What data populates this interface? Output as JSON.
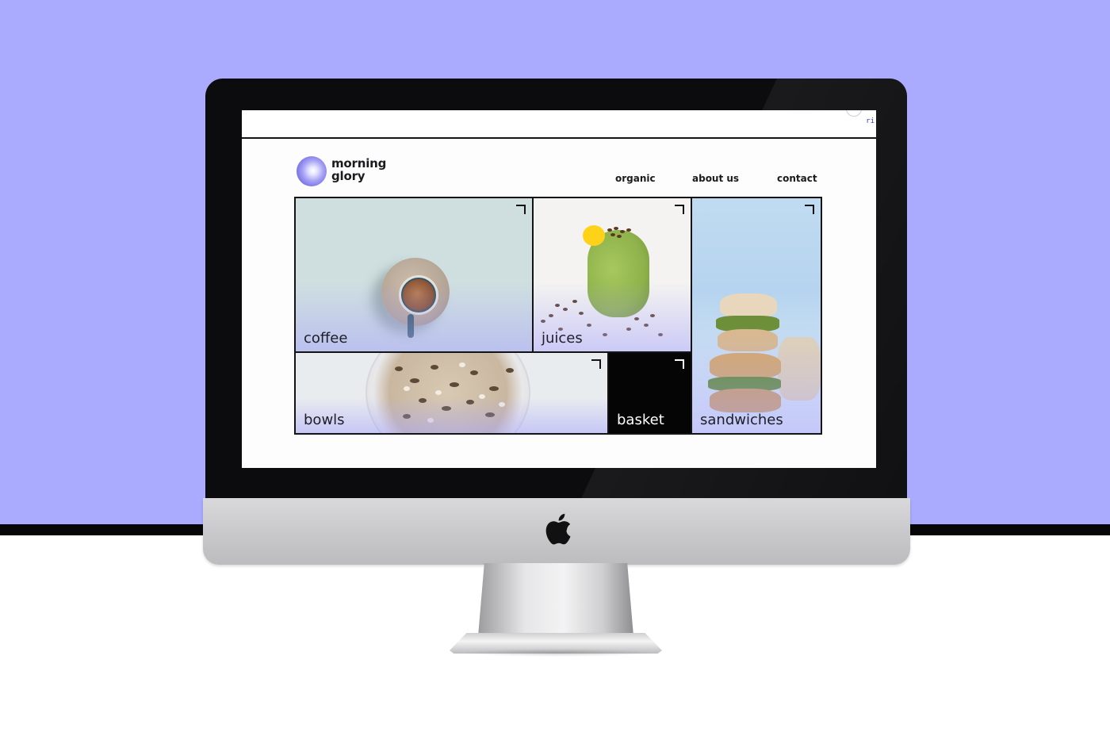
{
  "brand": {
    "line1": "morning",
    "line2": "glory"
  },
  "nav": {
    "organic": "organic",
    "about": "about us",
    "contact": "contact"
  },
  "topbar": {
    "code_fragment": "ri"
  },
  "tiles": {
    "coffee": "coffee",
    "juices": "juices",
    "sandwiches": "sandwiches",
    "bowls": "bowls",
    "basket": "basket"
  },
  "colors": {
    "backdrop": "#aaaafe",
    "accent": "#6d66e2",
    "ink": "#1b1b1f"
  },
  "icons": {
    "logo": "orb-logo-icon",
    "tile_corner": "corner-arrow-icon",
    "apple": "apple-logo-icon"
  }
}
